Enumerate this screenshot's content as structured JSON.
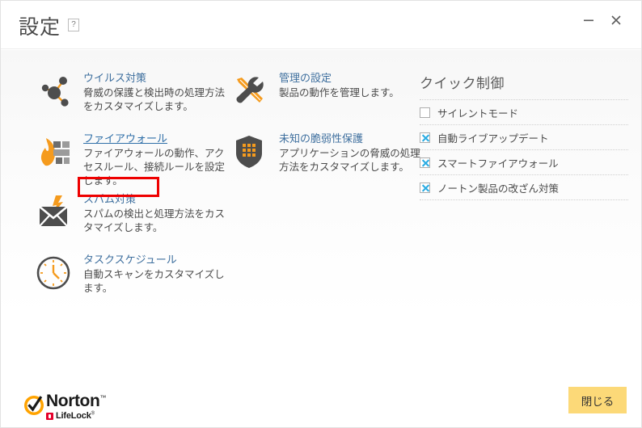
{
  "window": {
    "title": "設定",
    "help_badge": "?",
    "minimize_label": "最小化",
    "close_label": "閉じる"
  },
  "settings": {
    "column_left": [
      {
        "id": "antivirus",
        "icon": "molecule-icon",
        "title": "ウイルス対策",
        "desc": "脅威の保護と検出時の処理方法をカスタマイズします。",
        "highlighted": false
      },
      {
        "id": "firewall",
        "icon": "firewall-flame-icon",
        "title": "ファイアウォール",
        "desc": "ファイアウォールの動作、アクセスルール、接続ルールを設定します。",
        "highlighted": true
      },
      {
        "id": "antispam",
        "icon": "spam-mail-icon",
        "title": "スパム対策",
        "desc": "スパムの検出と処理方法をカスタマイズします。",
        "highlighted": false
      },
      {
        "id": "task-schedule",
        "icon": "clock-icon",
        "title": "タスクスケジュール",
        "desc": "自動スキャンをカスタマイズします。",
        "highlighted": false
      }
    ],
    "column_right": [
      {
        "id": "administrative",
        "icon": "wrench-screwdriver-icon",
        "title": "管理の設定",
        "desc": "製品の動作を管理します。",
        "highlighted": false
      },
      {
        "id": "intrusion-prevention",
        "icon": "shield-grid-icon",
        "title": "未知の脆弱性保護",
        "desc": "アプリケーションの脅威の処理方法をカスタマイズします。",
        "highlighted": false
      }
    ]
  },
  "quick_controls": {
    "title": "クイック制御",
    "items": [
      {
        "id": "silent-mode",
        "label": "サイレントモード",
        "checked": false
      },
      {
        "id": "auto-liveupdate",
        "label": "自動ライブアップデート",
        "checked": true
      },
      {
        "id": "smart-firewall",
        "label": "スマートファイアウォール",
        "checked": true
      },
      {
        "id": "tamper-protection",
        "label": "ノートン製品の改ざん対策",
        "checked": true
      }
    ]
  },
  "footer": {
    "brand_primary": "Norton",
    "brand_trademark": "™",
    "brand_secondary": "LifeLock",
    "brand_secondary_mark": "®",
    "close_button": "閉じる"
  },
  "colors": {
    "accent_orange": "#f59b1e",
    "link_blue": "#2f6fa8",
    "checkbox_blue": "#29abe2",
    "button_yellow": "#fcd978",
    "annotation_red": "#ee0000",
    "icon_gray": "#555555"
  }
}
